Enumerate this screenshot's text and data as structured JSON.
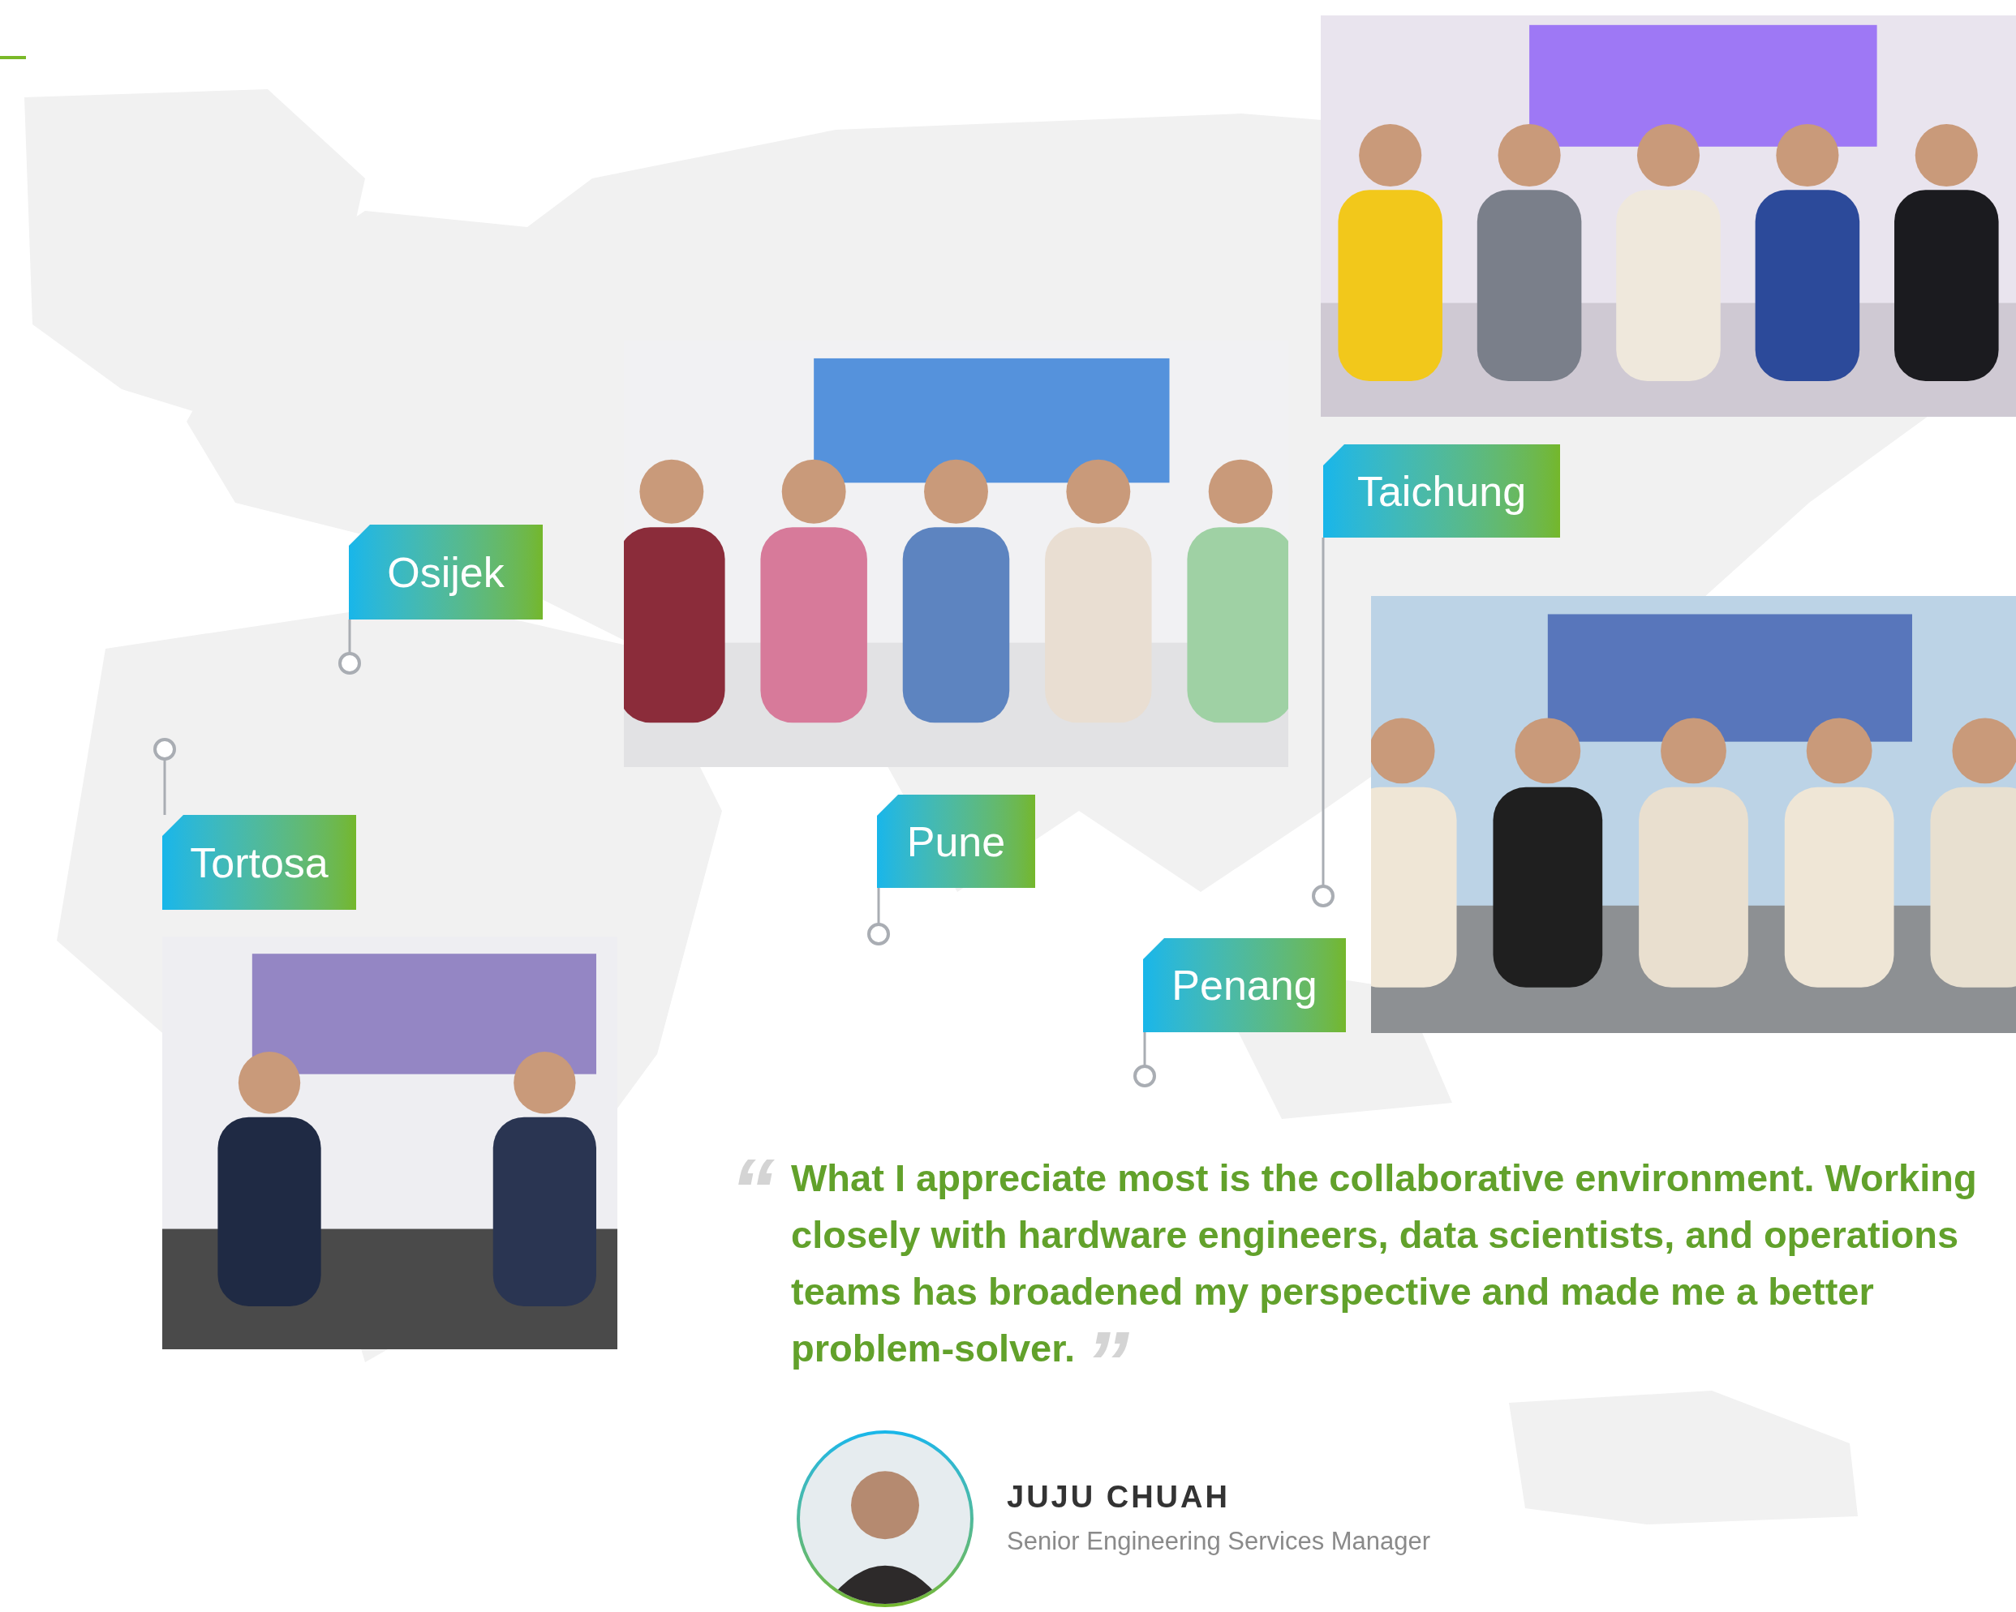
{
  "locations": [
    {
      "label": "Osijek"
    },
    {
      "label": "Tortosa"
    },
    {
      "label": "Pune"
    },
    {
      "label": "Taichung"
    },
    {
      "label": "Penang"
    }
  ],
  "quote": {
    "open_mark": "“",
    "text": "What I appreciate most is the collaborative environment. Working closely with hardware engineers, data scientists, and operations teams has broadened my perspective and made me a better problem-solver.",
    "close_mark": "”"
  },
  "author": {
    "name": "JUJU CHUAH",
    "title": "Senior Engineering Services Manager"
  }
}
